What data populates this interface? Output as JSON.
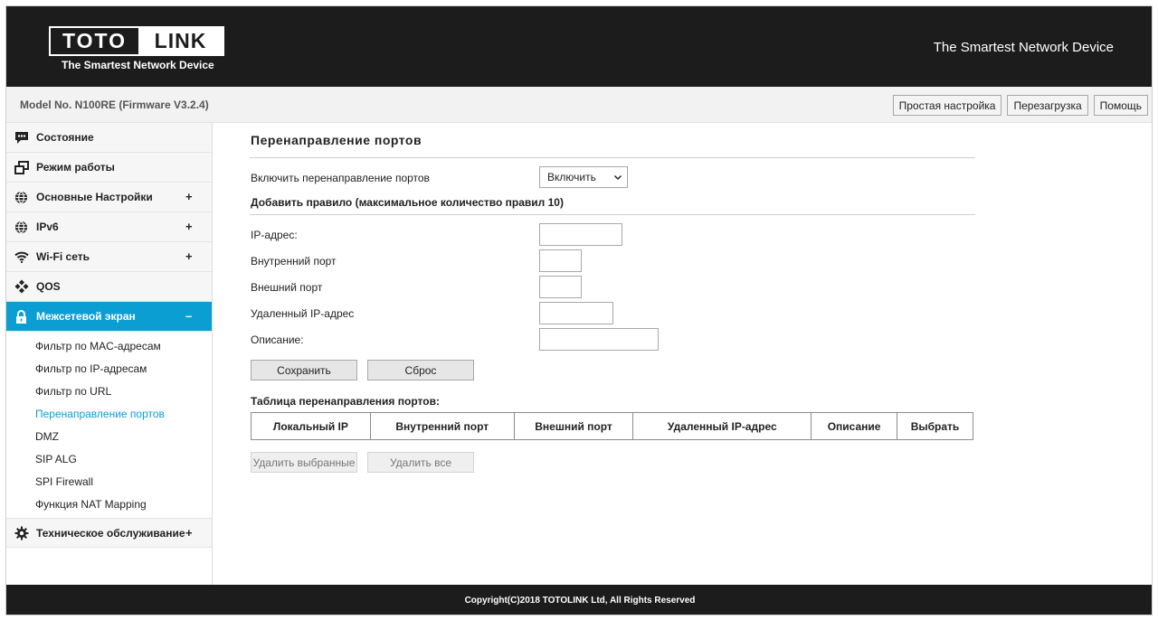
{
  "header": {
    "logo_left": "TOTO",
    "logo_right": "LINK",
    "logo_tagline": "The Smartest Network Device",
    "slogan": "The Smartest Network Device"
  },
  "modelbar": {
    "model_text": "Model No. N100RE (Firmware V3.2.4)",
    "buttons": [
      "Простая настройка",
      "Перезагрузка",
      "Помощь"
    ]
  },
  "sidebar": {
    "items": [
      {
        "label": "Состояние",
        "icon": "chat-bubble-icon",
        "expand": ""
      },
      {
        "label": "Режим работы",
        "icon": "windows-icon",
        "expand": ""
      },
      {
        "label": "Основные Настройки",
        "icon": "globe-icon",
        "expand": "+"
      },
      {
        "label": "IPv6",
        "icon": "globe-icon",
        "expand": "+"
      },
      {
        "label": "Wi-Fi сеть",
        "icon": "wifi-icon",
        "expand": "+"
      },
      {
        "label": "QOS",
        "icon": "diamond-grid-icon",
        "expand": ""
      },
      {
        "label": "Межсетевой экран",
        "icon": "lock-icon",
        "expand": "–"
      }
    ],
    "subitems": [
      "Фильтр по MAC-адресам",
      "Фильтр по IP-адресам",
      "Фильтр по URL",
      "Перенаправление портов",
      "DMZ",
      "SIP ALG",
      "SPI Firewall",
      "Функция NAT Mapping"
    ],
    "current_subitem": "Перенаправление портов",
    "maintenance": {
      "label": "Техническое обслуживание",
      "icon": "gear-icon",
      "expand": "+"
    }
  },
  "content": {
    "title": "Перенаправление портов",
    "enable_label": "Включить перенаправление портов",
    "enable_value": "Включить",
    "add_rule_title": "Добавить правило (максимальное количество правил 10)",
    "fields": [
      {
        "label": "IP-адрес:",
        "value": ""
      },
      {
        "label": "Внутренний порт",
        "value": ""
      },
      {
        "label": "Внешний порт",
        "value": ""
      },
      {
        "label": "Удаленный IP-адрес",
        "value": ""
      },
      {
        "label": "Описание:",
        "value": ""
      }
    ],
    "save_button": "Сохранить",
    "reset_button": "Сброс",
    "table_title": "Таблица перенаправления портов:",
    "table_headers": [
      "Локальный IP",
      "Внутренний порт",
      "Внешний порт",
      "Удаленный IP-адрес",
      "Описание",
      "Выбрать"
    ],
    "delete_selected_button": "Удалить выбранные",
    "delete_all_button": "Удалить все"
  },
  "footer": {
    "copyright": "Copyright(C)2018 TOTOLINK Ltd, All Rights Reserved"
  },
  "colors": {
    "accent": "#0b9ed3",
    "header_bg": "#1c1c1c"
  }
}
